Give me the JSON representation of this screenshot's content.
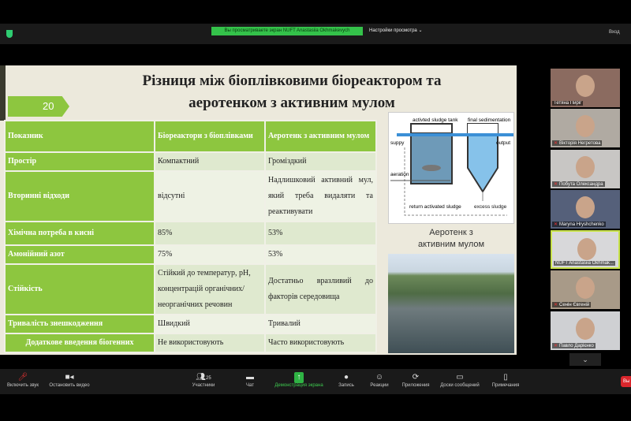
{
  "header": {
    "share_banner": "Вы просматриваете экран NUFT Anastasiia Okhmakevych",
    "view_options": "Настройки просмотра",
    "login": "Вход"
  },
  "slide": {
    "title_line1": "Різниця між біоплівковими біореактором та",
    "title_line2": "аеротенком з активним мулом",
    "number": "20",
    "table": {
      "headers": [
        "Показник",
        "Біореактори з біоплівками",
        "Аеротенк з активним мулом"
      ],
      "rows": [
        [
          "Простір",
          "Компактний",
          "Громіздкий"
        ],
        [
          "Вторинні відходи",
          "відсутні",
          "Надлишковий активний мул, який треба видаляти та реактивувати"
        ],
        [
          "Хімічна потреба в кисні",
          "85%",
          "53%"
        ],
        [
          "Амонійний азот",
          "75%",
          "53%"
        ],
        [
          "Стійкість",
          "Стійкий до температур, pH, концентрацій органічних/неорганічних речовин",
          "Достатньо вразливий до факторів середовища"
        ],
        [
          "Тривалість знешкодження",
          "Швидкий",
          "Тривалий"
        ],
        [
          "Додаткове введення біогенних",
          "Не використовують",
          "Часто використовують"
        ]
      ]
    },
    "diagram": {
      "tank": "activted sludge tank",
      "sedimentation": "final sedimentation",
      "supply": "suppy",
      "output": "output",
      "aeration": "aeration",
      "return": "return activated sludge",
      "excess": "excess sludge"
    },
    "caption_line1": "Аеротенк з",
    "caption_line2": "активним мулом"
  },
  "participants": [
    {
      "name": "Тетяна Пиріг",
      "muted": false
    },
    {
      "name": "Вікторія Негретова",
      "muted": true
    },
    {
      "name": "Побута Олександра",
      "muted": true
    },
    {
      "name": "Maryna Hryshchenko",
      "muted": true
    },
    {
      "name": "NUFT Anastasiia Okhmak...",
      "muted": false,
      "active": true
    },
    {
      "name": "Сенін Євгеній",
      "muted": true
    },
    {
      "name": "Павло Дарієнко",
      "muted": true
    }
  ],
  "toolbar": {
    "unmute": "Включить звук",
    "stop_video": "Остановить видео",
    "participants": "Участники",
    "participants_count": "25",
    "chat": "Чат",
    "share": "Демонстрация экрана",
    "record": "Запись",
    "reactions": "Реакции",
    "apps": "Приложения",
    "whiteboards": "Доски сообщений",
    "notes": "Примечания",
    "leave": "Вы"
  }
}
